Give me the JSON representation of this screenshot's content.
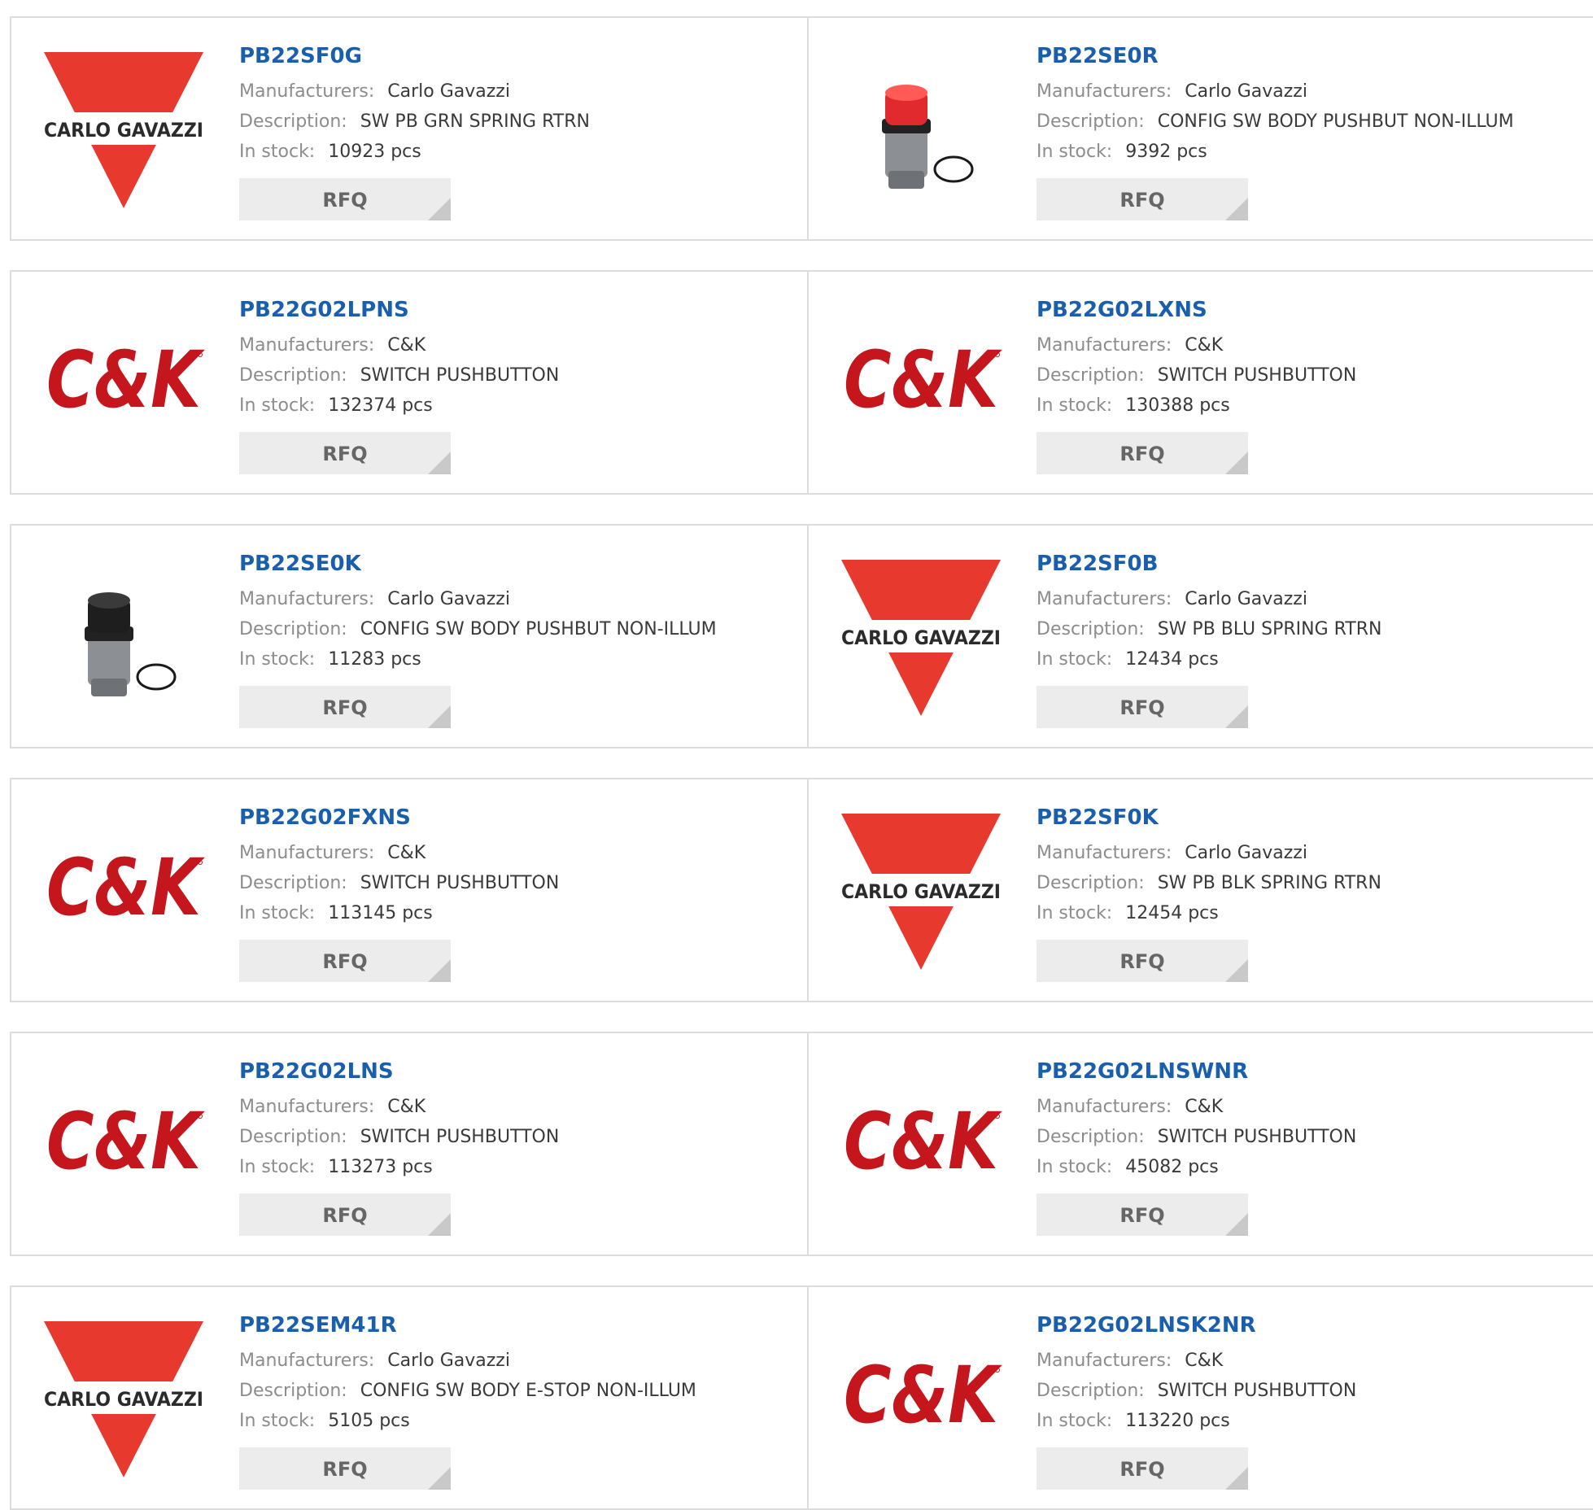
{
  "labels": {
    "manufacturers": "Manufacturers:",
    "description": "Description:",
    "stock": "In stock:",
    "rfq": "RFQ"
  },
  "colors": {
    "part_link": "#1a5fad",
    "carlo_red": "#e8392e",
    "ck_red": "#c4161c"
  },
  "products": [
    {
      "part": "PB22SF0G",
      "manufacturer": "Carlo Gavazzi",
      "description": "SW PB GRN SPRING RTRN",
      "stock": "10923 pcs",
      "image": "carlo-gavazzi-logo"
    },
    {
      "part": "PB22SE0R",
      "manufacturer": "Carlo Gavazzi",
      "description": "CONFIG SW BODY PUSHBUT NON-ILLUM",
      "stock": "9392 pcs",
      "image": "red-pushbutton-photo"
    },
    {
      "part": "PB22G02LPNS",
      "manufacturer": "C&K",
      "description": "SWITCH PUSHBUTTON",
      "stock": "132374 pcs",
      "image": "ck-logo"
    },
    {
      "part": "PB22G02LXNS",
      "manufacturer": "C&K",
      "description": "SWITCH PUSHBUTTON",
      "stock": "130388 pcs",
      "image": "ck-logo"
    },
    {
      "part": "PB22SE0K",
      "manufacturer": "Carlo Gavazzi",
      "description": "CONFIG SW BODY PUSHBUT NON-ILLUM",
      "stock": "11283 pcs",
      "image": "black-pushbutton-photo"
    },
    {
      "part": "PB22SF0B",
      "manufacturer": "Carlo Gavazzi",
      "description": "SW PB BLU SPRING RTRN",
      "stock": "12434 pcs",
      "image": "carlo-gavazzi-logo"
    },
    {
      "part": "PB22G02FXNS",
      "manufacturer": "C&K",
      "description": "SWITCH PUSHBUTTON",
      "stock": "113145 pcs",
      "image": "ck-logo"
    },
    {
      "part": "PB22SF0K",
      "manufacturer": "Carlo Gavazzi",
      "description": "SW PB BLK SPRING RTRN",
      "stock": "12454 pcs",
      "image": "carlo-gavazzi-logo"
    },
    {
      "part": "PB22G02LNS",
      "manufacturer": "C&K",
      "description": "SWITCH PUSHBUTTON",
      "stock": "113273 pcs",
      "image": "ck-logo"
    },
    {
      "part": "PB22G02LNSWNR",
      "manufacturer": "C&K",
      "description": "SWITCH PUSHBUTTON",
      "stock": "45082 pcs",
      "image": "ck-logo"
    },
    {
      "part": "PB22SEM41R",
      "manufacturer": "Carlo Gavazzi",
      "description": "CONFIG SW BODY E-STOP NON-ILLUM",
      "stock": "5105 pcs",
      "image": "carlo-gavazzi-logo"
    },
    {
      "part": "PB22G02LNSK2NR",
      "manufacturer": "C&K",
      "description": "SWITCH PUSHBUTTON",
      "stock": "113220 pcs",
      "image": "ck-logo"
    }
  ],
  "logo_text": {
    "carlo": "CARLO GAVAZZI",
    "ck": "C&K"
  }
}
